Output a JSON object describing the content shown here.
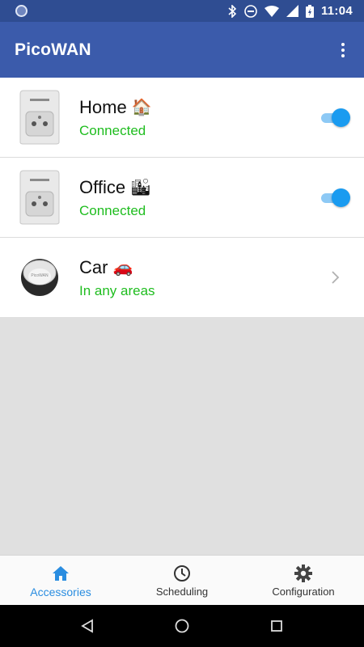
{
  "status_bar": {
    "time": "11:04"
  },
  "app_bar": {
    "title": "PicoWAN"
  },
  "accessories": [
    {
      "name": "Home",
      "emoji": "🏠",
      "status": "Connected",
      "device": "plug",
      "toggle_on": true
    },
    {
      "name": "Office",
      "emoji": "🏙",
      "status": "Connected",
      "device": "plug",
      "toggle_on": true
    },
    {
      "name": "Car",
      "emoji": "🚗",
      "status": "In any areas",
      "device": "tracker"
    }
  ],
  "bottom_nav": [
    {
      "label": "Accessories",
      "icon": "home-icon",
      "active": true
    },
    {
      "label": "Scheduling",
      "icon": "clock-icon",
      "active": false
    },
    {
      "label": "Configuration",
      "icon": "gear-icon",
      "active": false
    }
  ],
  "colors": {
    "status_bar": "#2f4d92",
    "app_bar": "#3b5bab",
    "connected": "#1fbd1f",
    "accent": "#1a9bf0",
    "active_tab": "#2a8de0",
    "background": "#e0e0e0"
  }
}
